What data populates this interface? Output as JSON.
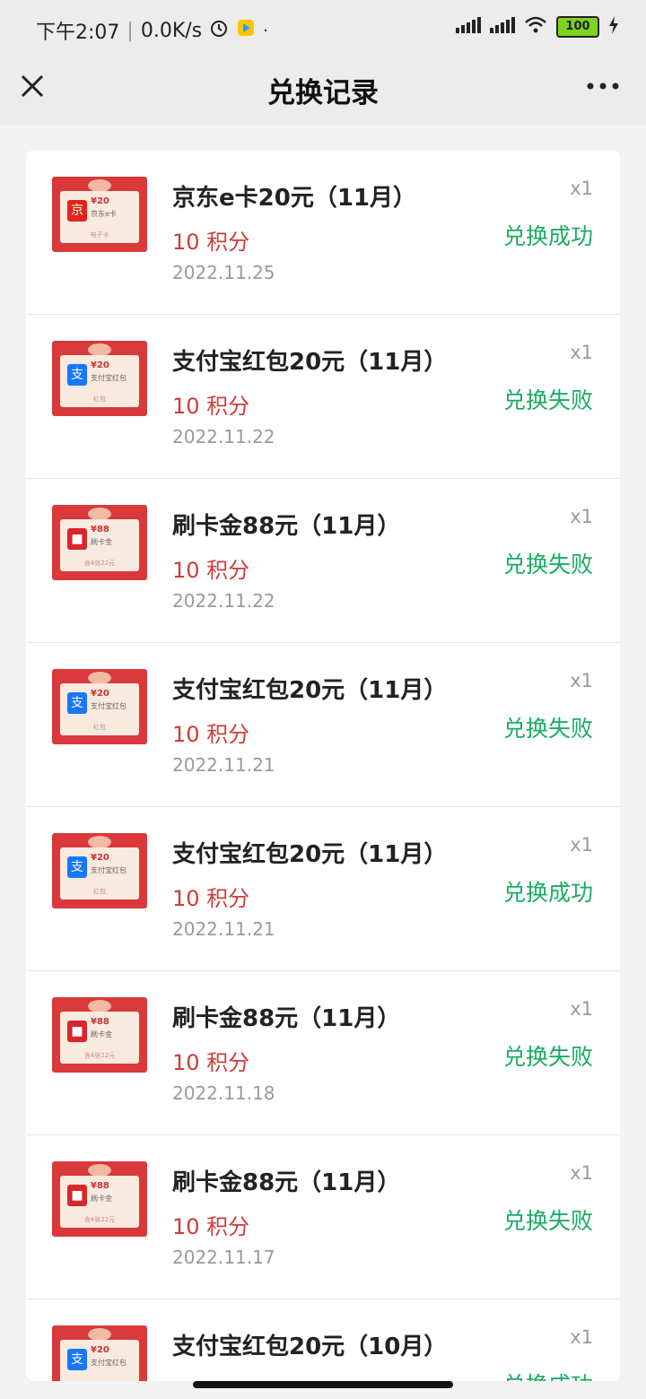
{
  "status_bar": {
    "time": "下午2:07",
    "speed": "0.0K/s",
    "battery": "100"
  },
  "nav": {
    "title": "兑换记录"
  },
  "records": [
    {
      "title": "京东e卡20元（11月）",
      "points": "10 积分",
      "date": "2022.11.25",
      "qty": "x1",
      "status": "兑换成功",
      "kind": "jd",
      "thumb_amount": "¥20",
      "thumb_name": "京东e卡",
      "thumb_foot": "电子卡"
    },
    {
      "title": "支付宝红包20元（11月）",
      "points": "10 积分",
      "date": "2022.11.22",
      "qty": "x1",
      "status": "兑换失败",
      "kind": "alipay",
      "thumb_amount": "¥20",
      "thumb_name": "支付宝红包",
      "thumb_foot": "红包"
    },
    {
      "title": "刷卡金88元（11月）",
      "points": "10 积分",
      "date": "2022.11.22",
      "qty": "x1",
      "status": "兑换失败",
      "kind": "card",
      "thumb_amount": "¥88",
      "thumb_name": "刷卡金",
      "thumb_foot": "含4张22元"
    },
    {
      "title": "支付宝红包20元（11月）",
      "points": "10 积分",
      "date": "2022.11.21",
      "qty": "x1",
      "status": "兑换失败",
      "kind": "alipay",
      "thumb_amount": "¥20",
      "thumb_name": "支付宝红包",
      "thumb_foot": "红包"
    },
    {
      "title": "支付宝红包20元（11月）",
      "points": "10 积分",
      "date": "2022.11.21",
      "qty": "x1",
      "status": "兑换成功",
      "kind": "alipay",
      "thumb_amount": "¥20",
      "thumb_name": "支付宝红包",
      "thumb_foot": "红包"
    },
    {
      "title": "刷卡金88元（11月）",
      "points": "10 积分",
      "date": "2022.11.18",
      "qty": "x1",
      "status": "兑换失败",
      "kind": "card",
      "thumb_amount": "¥88",
      "thumb_name": "刷卡金",
      "thumb_foot": "含4张22元"
    },
    {
      "title": "刷卡金88元（11月）",
      "points": "10 积分",
      "date": "2022.11.17",
      "qty": "x1",
      "status": "兑换失败",
      "kind": "card",
      "thumb_amount": "¥88",
      "thumb_name": "刷卡金",
      "thumb_foot": "含4张22元"
    },
    {
      "title": "支付宝红包20元（10月）",
      "points": "",
      "date": "",
      "qty": "x1",
      "status": "兑换成功",
      "kind": "alipay",
      "thumb_amount": "¥20",
      "thumb_name": "支付宝红包",
      "thumb_foot": ""
    }
  ],
  "colors": {
    "success": "#1aad63",
    "fail": "#1aad63",
    "points": "#d03a3a",
    "jd_badge": "#e1251b",
    "alipay_badge": "#1677ff",
    "card_badge": "#d8262c"
  },
  "icons": {
    "close": "close-icon",
    "more": "more-icon"
  }
}
